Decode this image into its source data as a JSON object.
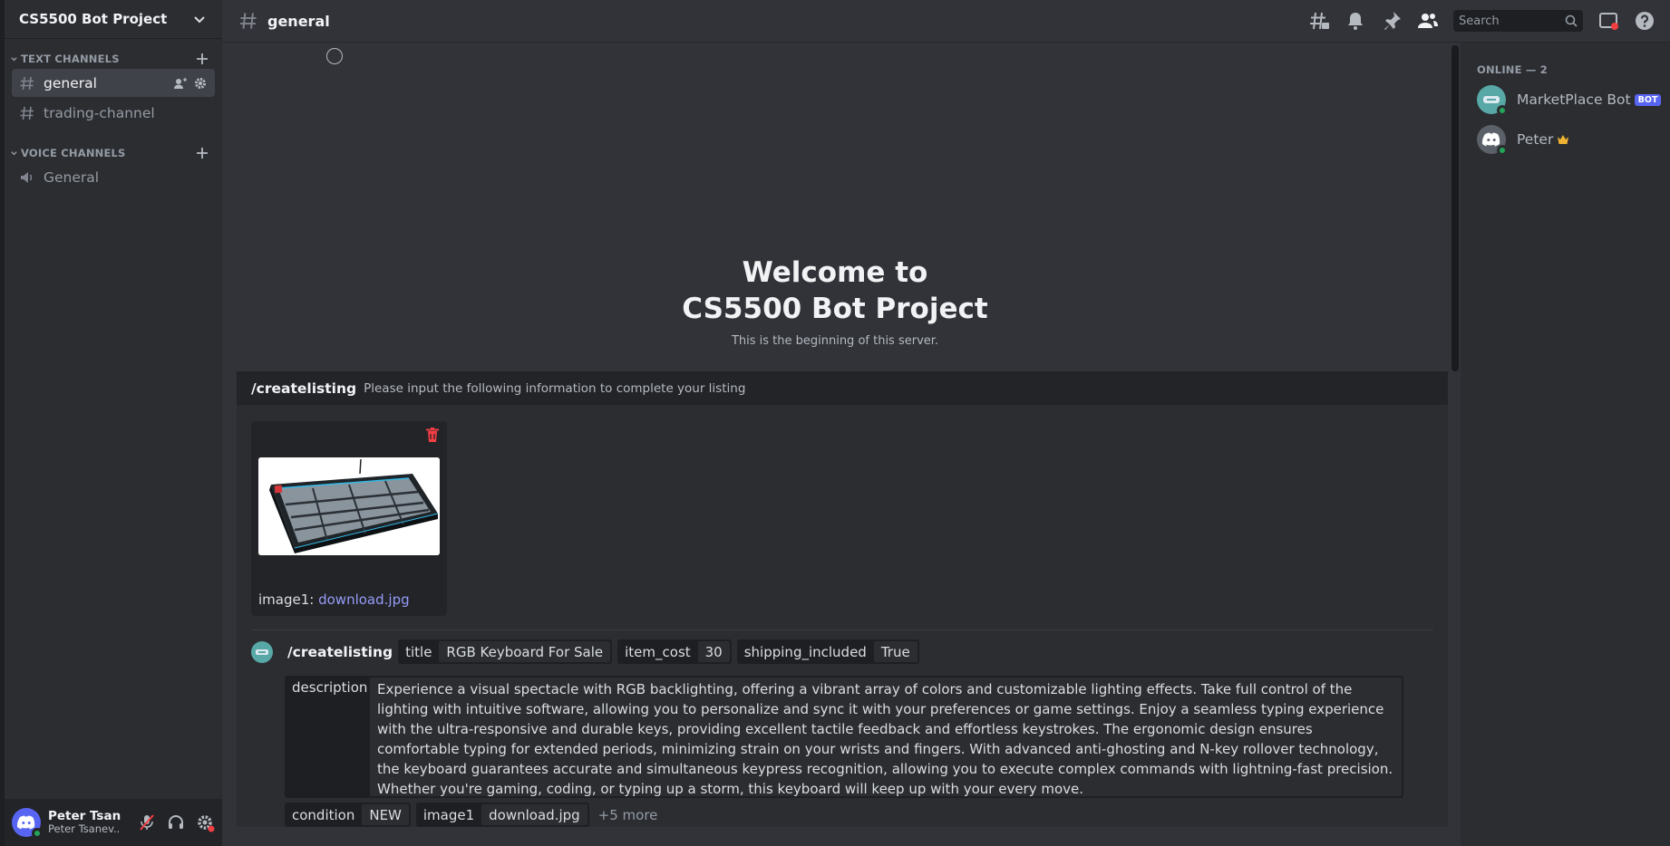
{
  "server": {
    "name": "CS5500 Bot Project"
  },
  "sidebar": {
    "text_category": "TEXT CHANNELS",
    "voice_category": "VOICE CHANNELS",
    "text_channels": [
      {
        "label": "general",
        "selected": true
      },
      {
        "label": "trading-channel",
        "selected": false
      }
    ],
    "voice_channels": [
      {
        "label": "General"
      }
    ]
  },
  "user": {
    "name": "Peter Tsan...",
    "tag": "Peter Tsanev..."
  },
  "header": {
    "channel": "general",
    "search_placeholder": "Search"
  },
  "welcome": {
    "line1": "Welcome to",
    "line2": "CS5500 Bot Project",
    "subtitle": "This is the beginning of this server."
  },
  "form": {
    "command": "/createlisting",
    "hint": "Please input the following information to complete your listing",
    "attachment_label": "image1:",
    "attachment_file": "download.jpg"
  },
  "message": {
    "command": "/createlisting",
    "options": [
      {
        "key": "title",
        "value": "RGB Keyboard For Sale"
      },
      {
        "key": "item_cost",
        "value": "30"
      },
      {
        "key": "shipping_included",
        "value": "True"
      }
    ],
    "description_key": "description",
    "description_value": "Experience a visual spectacle with RGB backlighting, offering a vibrant array of colors and customizable lighting effects. Take full control of the lighting with intuitive software, allowing you to personalize and sync it with your preferences or game settings.  Enjoy a seamless typing experience with the ultra-responsive and durable keys, providing excellent tactile feedback and effortless keystrokes. The ergonomic design ensures comfortable typing for extended periods, minimizing strain on your wrists and fingers.  With advanced anti-ghosting and N-key rollover technology, the keyboard guarantees accurate and simultaneous keypress recognition, allowing you to execute complex commands with lightning-fast precision. Whether you're gaming, coding, or typing up a storm, this keyboard will keep up with your every move.",
    "condition_key": "condition",
    "condition_value": "NEW",
    "image_key": "image1",
    "image_value": "download.jpg",
    "more": "+5 more"
  },
  "members": {
    "heading": "ONLINE — 2",
    "list": [
      {
        "name": "MarketPlace Bot",
        "badge": "BOT"
      },
      {
        "name": "Peter"
      }
    ]
  },
  "colors": {
    "accent": "#5865f2",
    "online": "#23a55a",
    "link": "#949cf7",
    "danger": "#f23f43"
  }
}
